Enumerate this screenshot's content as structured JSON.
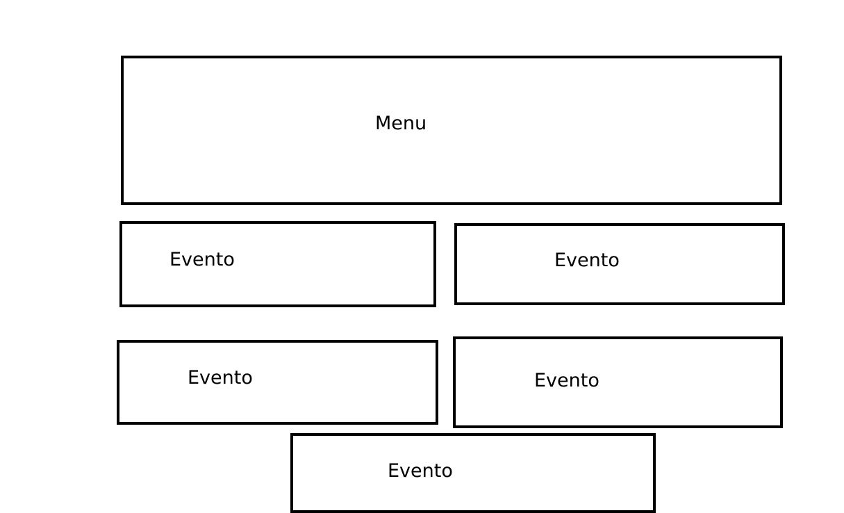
{
  "menu": {
    "label": "Menu"
  },
  "events": [
    {
      "label": "Evento"
    },
    {
      "label": "Evento"
    },
    {
      "label": "Evento"
    },
    {
      "label": "Evento"
    },
    {
      "label": "Evento"
    }
  ]
}
